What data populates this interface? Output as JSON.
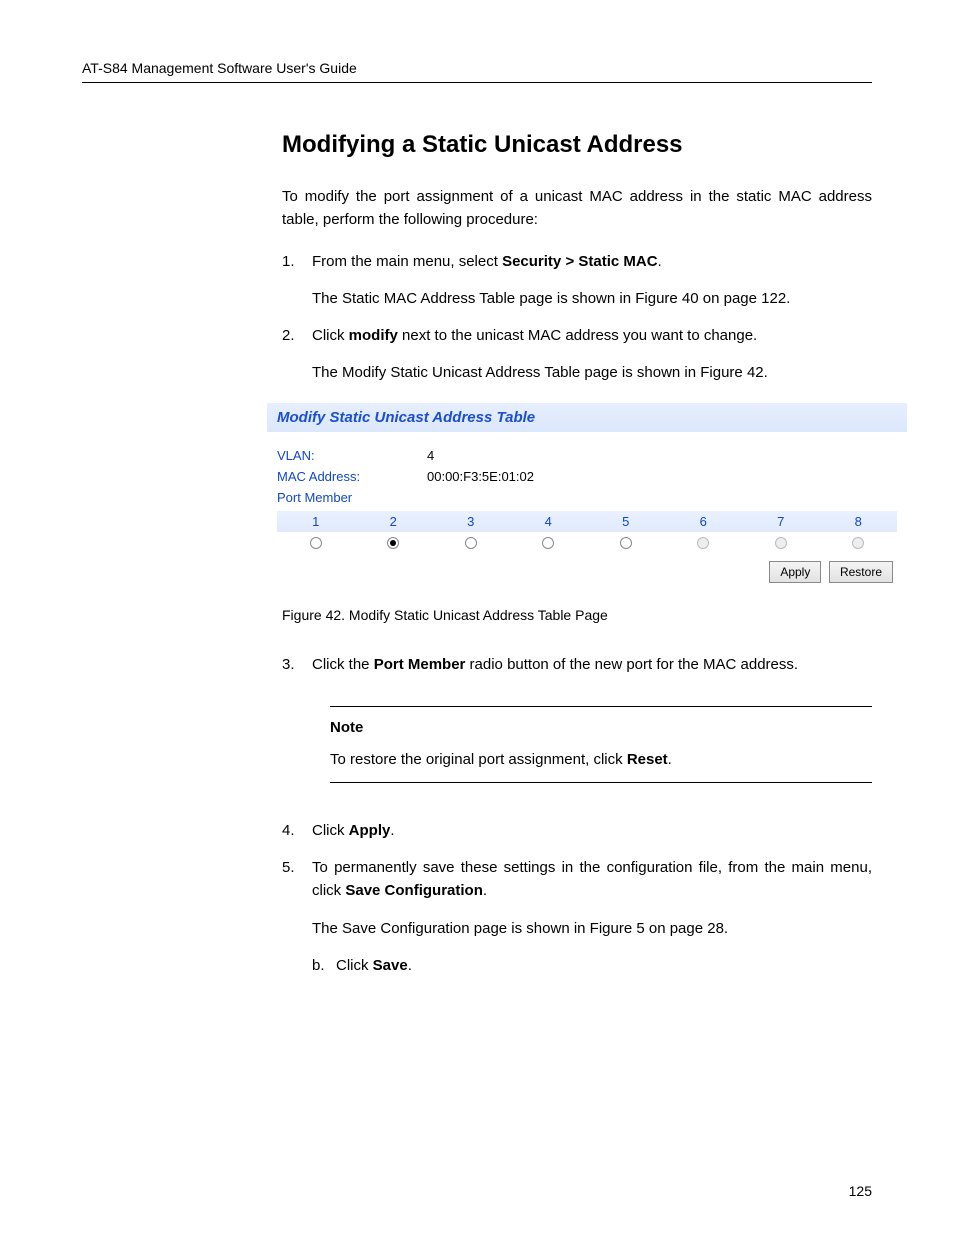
{
  "header": {
    "left": "AT-S84 Management Software User's Guide",
    "right": "",
    "chapter": ""
  },
  "section_title": "Modifying a Static Unicast Address",
  "intro": "To modify the port assignment of a unicast MAC address in the static MAC address table, perform the following procedure:",
  "steps": [
    "From the main menu, select Security > Static MAC.",
    "The Static MAC Address Table page is shown in Figure 40 on page 122.",
    "Click modify next to the unicast MAC address you want to change.",
    "The Modify Static Unicast Address Table page is shown in Figure 42."
  ],
  "figure": {
    "panel_title": "Modify Static Unicast Address Table",
    "vlan_label": "VLAN:",
    "vlan_value": "4",
    "mac_label": "MAC Address:",
    "mac_value": "00:00:F3:5E:01:02",
    "port_member_label": "Port Member",
    "ports": [
      "1",
      "2",
      "3",
      "4",
      "5",
      "6",
      "7",
      "8"
    ],
    "selected_port_index": 1,
    "disabled_port_indices": [
      5,
      6,
      7
    ],
    "apply_label": "Apply",
    "restore_label": "Restore",
    "caption": "Figure 42. Modify Static Unicast Address Table Page"
  },
  "step3": {
    "num": "3.",
    "text_prefix": "Click the ",
    "bold": "Port Member",
    "text_suffix": " radio button of the new port for the MAC address."
  },
  "note": {
    "label": "Note",
    "text_prefix": "To restore the original port assignment, click ",
    "bold": "Reset",
    "text_suffix": "."
  },
  "step4": {
    "num": "4.",
    "text_prefix": "Click ",
    "bold": "Apply",
    "text_suffix": "."
  },
  "step5": {
    "num": "5.",
    "text": "To permanently save these settings in the configuration file, from the main menu, click ",
    "bold": "Save Configuration",
    "text_after": "."
  },
  "save_para1": "The Save Configuration page is shown in Figure 5 on page 28.",
  "sub_b": {
    "bullet": "b.",
    "text_prefix": "Click ",
    "bold": "Save",
    "text_suffix": "."
  },
  "footer_page": "125"
}
